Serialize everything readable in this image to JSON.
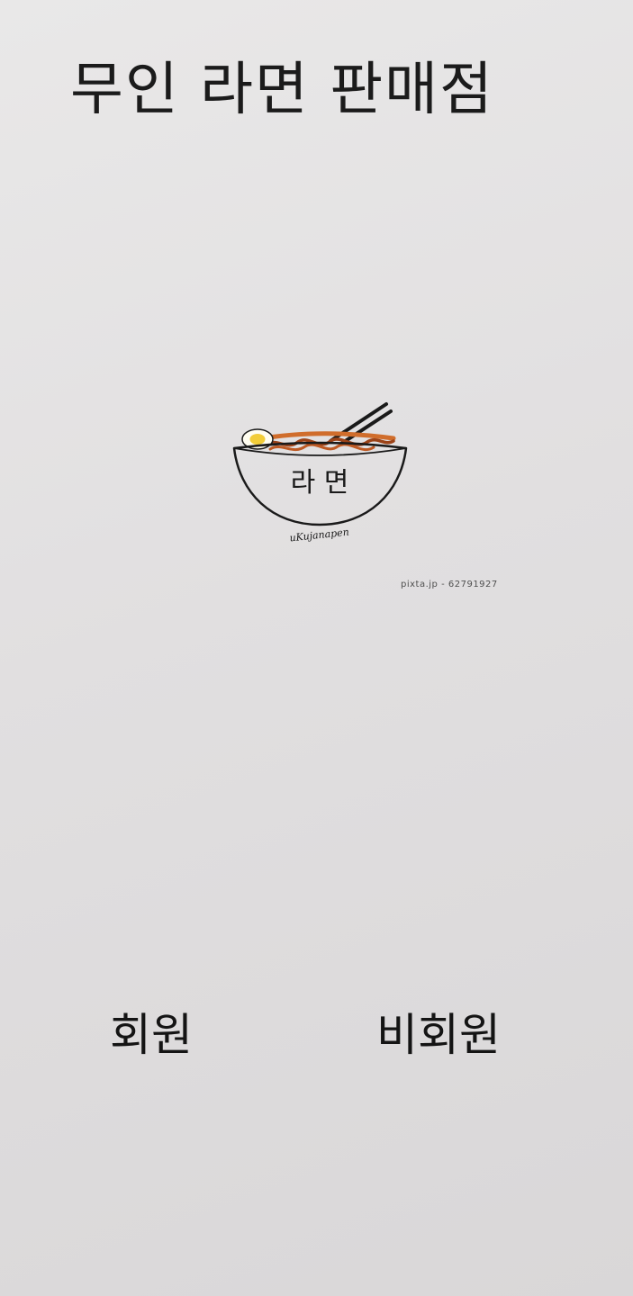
{
  "app": {
    "title": "무인 라면 판매점"
  },
  "hero": {
    "icon": "ramen-bowl-icon",
    "bowl_label": "라 면",
    "signature": "uKujanapen",
    "watermark": "pixta.jp - 62791927",
    "colors": {
      "noodle": "#c65a1e",
      "egg_yolk": "#f2cd38",
      "outline": "#1a1a1a"
    }
  },
  "actions": {
    "member_label": "회원",
    "guest_label": "비회원"
  }
}
